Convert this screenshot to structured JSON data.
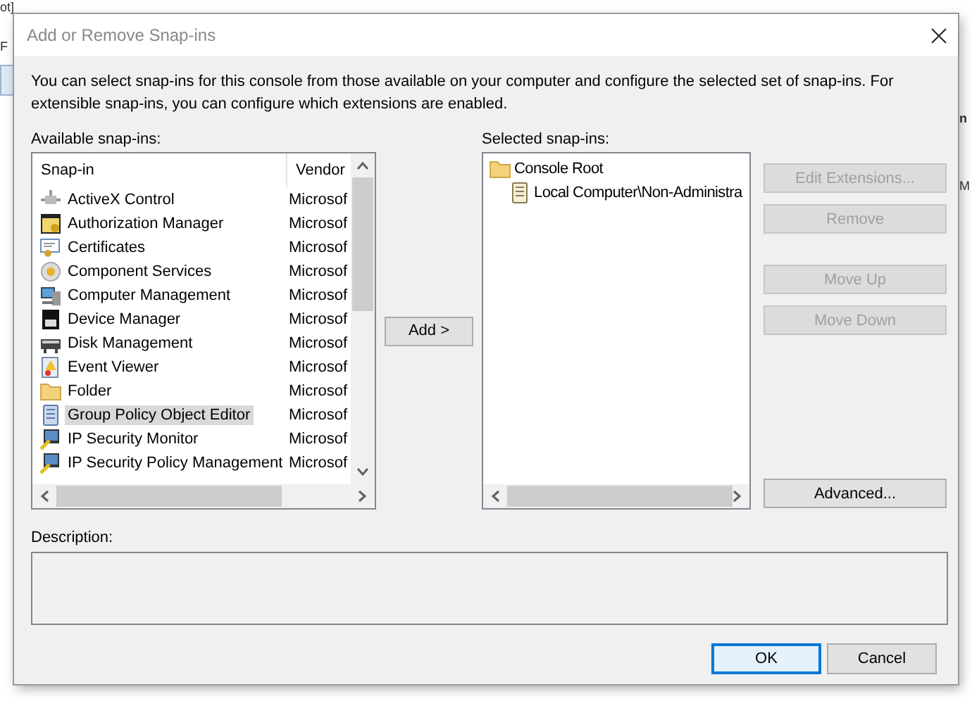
{
  "backdrop": {
    "fragments": [
      {
        "text": "ot]"
      },
      {
        "text": "F"
      },
      {
        "text": "n"
      },
      {
        "text": "M"
      }
    ]
  },
  "window": {
    "title": "Add or Remove Snap-ins"
  },
  "intro": "You can select snap-ins for this console from those available on your computer and configure the selected set of snap-ins. For extensible snap-ins, you can configure which extensions are enabled.",
  "available": {
    "label": "Available snap-ins:",
    "columns": [
      "Snap-in",
      "Vendor"
    ],
    "rows": [
      {
        "name": "ActiveX Control",
        "vendor": "Microsof",
        "selected": false
      },
      {
        "name": "Authorization Manager",
        "vendor": "Microsof",
        "selected": false
      },
      {
        "name": "Certificates",
        "vendor": "Microsof",
        "selected": false
      },
      {
        "name": "Component Services",
        "vendor": "Microsof",
        "selected": false
      },
      {
        "name": "Computer Management",
        "vendor": "Microsof",
        "selected": false
      },
      {
        "name": "Device Manager",
        "vendor": "Microsof",
        "selected": false
      },
      {
        "name": "Disk Management",
        "vendor": "Microsof",
        "selected": false
      },
      {
        "name": "Event Viewer",
        "vendor": "Microsof",
        "selected": false
      },
      {
        "name": "Folder",
        "vendor": "Microsof",
        "selected": false
      },
      {
        "name": "Group Policy Object Editor",
        "vendor": "Microsof",
        "selected": true
      },
      {
        "name": "IP Security Monitor",
        "vendor": "Microsof",
        "selected": false
      },
      {
        "name": "IP Security Policy Management",
        "vendor": "Microsof",
        "selected": false
      }
    ]
  },
  "add_button": {
    "label": "Add >",
    "disabled": false
  },
  "selected": {
    "label": "Selected snap-ins:",
    "tree": [
      {
        "label": "Console Root",
        "kind": "folder",
        "children": [
          {
            "label": "Local Computer\\Non-Administra",
            "kind": "policy"
          }
        ]
      }
    ]
  },
  "side_buttons": [
    {
      "label": "Edit Extensions...",
      "disabled": true
    },
    {
      "label": "Remove",
      "disabled": true
    },
    {
      "label": "Move Up",
      "disabled": true
    },
    {
      "label": "Move Down",
      "disabled": true
    },
    {
      "label": "Advanced...",
      "disabled": false
    }
  ],
  "description": {
    "label": "Description:"
  },
  "footer_buttons": [
    {
      "label": "OK",
      "default": true
    },
    {
      "label": "Cancel",
      "default": false
    }
  ]
}
